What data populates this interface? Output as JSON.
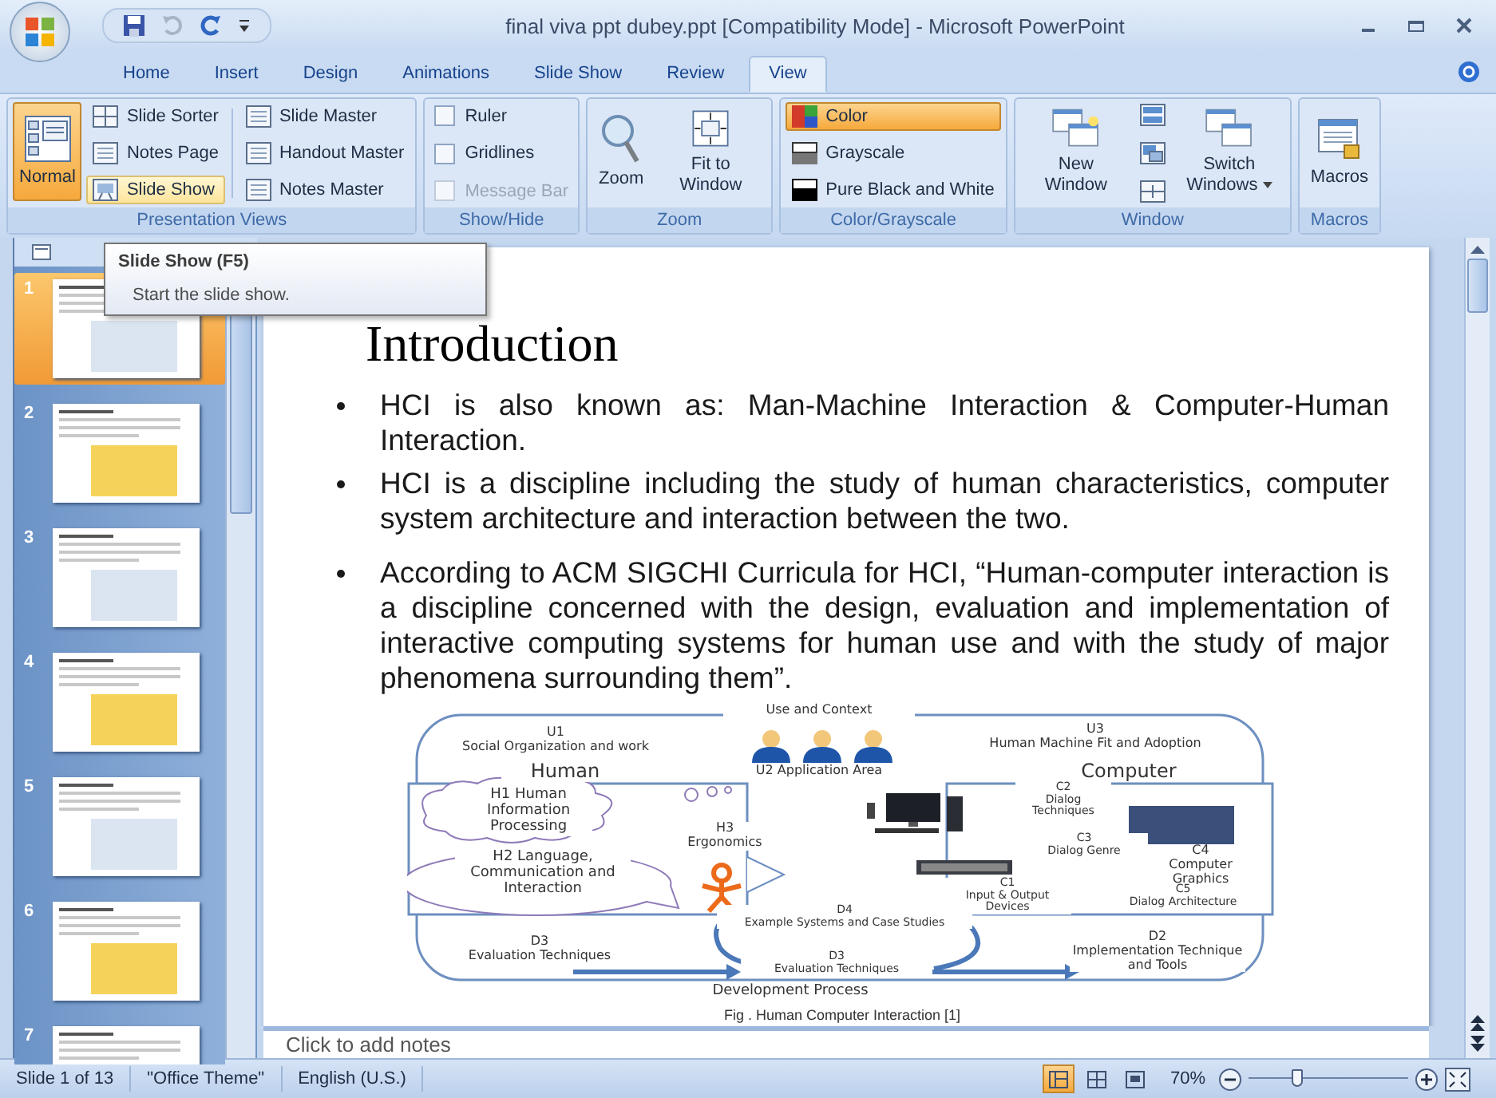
{
  "window": {
    "title": "final viva ppt dubey.ppt [Compatibility Mode] - Microsoft PowerPoint"
  },
  "ribbon_tabs": [
    {
      "label": "Home",
      "selected": false
    },
    {
      "label": "Insert",
      "selected": false
    },
    {
      "label": "Design",
      "selected": false
    },
    {
      "label": "Animations",
      "selected": false
    },
    {
      "label": "Slide Show",
      "selected": false
    },
    {
      "label": "Review",
      "selected": false
    },
    {
      "label": "View",
      "selected": true
    }
  ],
  "ribbon": {
    "groups": [
      {
        "title": "Presentation Views",
        "columns": [
          [
            {
              "kind": "large",
              "label": "Normal",
              "selected": true,
              "hovered": false
            }
          ],
          [
            {
              "kind": "small",
              "label": "Slide Sorter",
              "selected": false,
              "hovered": false
            },
            {
              "kind": "small",
              "label": "Notes Page",
              "selected": false,
              "hovered": false
            },
            {
              "kind": "small",
              "label": "Slide Show",
              "selected": false,
              "hovered": true
            }
          ],
          [
            {
              "kind": "small",
              "label": "Slide Master",
              "selected": false,
              "hovered": false
            },
            {
              "kind": "small",
              "label": "Handout Master",
              "selected": false,
              "hovered": false
            },
            {
              "kind": "small",
              "label": "Notes Master",
              "selected": false,
              "hovered": false
            }
          ]
        ]
      },
      {
        "title": "Show/Hide",
        "columns": [
          [
            {
              "kind": "check",
              "label": "Ruler",
              "checked": false,
              "disabled": false
            },
            {
              "kind": "check",
              "label": "Gridlines",
              "checked": false,
              "disabled": false
            },
            {
              "kind": "check",
              "label": "Message Bar",
              "checked": false,
              "disabled": true
            }
          ]
        ]
      },
      {
        "title": "Zoom",
        "columns": [
          [
            {
              "kind": "large",
              "label": "Zoom"
            }
          ],
          [
            {
              "kind": "large",
              "label": "Fit to Window"
            }
          ]
        ]
      },
      {
        "title": "Color/Grayscale",
        "columns": [
          [
            {
              "kind": "small",
              "label": "Color",
              "selected": true
            },
            {
              "kind": "small",
              "label": "Grayscale",
              "selected": false
            },
            {
              "kind": "small",
              "label": "Pure Black and White",
              "selected": false
            }
          ]
        ]
      },
      {
        "title": "Window",
        "columns": [
          [
            {
              "kind": "large",
              "label": "New Window"
            }
          ],
          [
            {
              "kind": "icon"
            },
            {
              "kind": "icon"
            },
            {
              "kind": "icon"
            }
          ],
          [
            {
              "kind": "large",
              "label": "Switch Windows"
            }
          ]
        ]
      },
      {
        "title": "Macros",
        "columns": [
          [
            {
              "kind": "large",
              "label": "Macros"
            }
          ]
        ]
      }
    ]
  },
  "tooltip": {
    "title": "Slide Show (F5)",
    "description": "Start the slide show."
  },
  "slides": [
    {
      "number": "1",
      "selected": true
    },
    {
      "number": "2",
      "selected": false
    },
    {
      "number": "3",
      "selected": false
    },
    {
      "number": "4",
      "selected": false
    },
    {
      "number": "5",
      "selected": false
    },
    {
      "number": "6",
      "selected": false
    },
    {
      "number": "7",
      "selected": false
    }
  ],
  "slide": {
    "title": "Introduction",
    "bullets": [
      "HCI is also known as: Man-Machine Interaction & Computer-Human Interaction.",
      "HCI is a discipline including the study of human characteristics, computer system architecture and interaction between the two.",
      "According to ACM SIGCHI Curricula for HCI, “Human-computer interaction is a discipline concerned with the design, evaluation and implementation of interactive computing systems for human use and with the study of major phenomena surrounding them”."
    ],
    "figure": {
      "labels": [
        {
          "text": "Use and Context"
        },
        {
          "code": "U1",
          "text": "Social Organization and work"
        },
        {
          "text": "U2 Application Area"
        },
        {
          "code": "U3",
          "text": "Human Machine Fit and Adoption"
        },
        {
          "text": "Human"
        },
        {
          "text": "Computer"
        },
        {
          "text": "H1 Human Information Processing"
        },
        {
          "text": "H2 Language, Communication and Interaction"
        },
        {
          "code": "H3",
          "text": "Ergonomics"
        },
        {
          "code": "C2",
          "text": "Dialog Techniques"
        },
        {
          "code": "C3",
          "text": "Dialog Genre"
        },
        {
          "code": "C4",
          "text": "Computer Graphics"
        },
        {
          "code": "C1",
          "text": "Input & Output Devices"
        },
        {
          "code": "C5",
          "text": "Dialog Architecture"
        },
        {
          "code": "D4",
          "text": "Example Systems and Case Studies"
        },
        {
          "code": "D3",
          "text": "Evaluation Techniques"
        },
        {
          "code": "D3",
          "text": "Evaluation Techniques"
        },
        {
          "code": "D2",
          "text": "Implementation Technique and Tools"
        },
        {
          "text": "Development Process"
        }
      ],
      "caption": "Fig . Human Computer Interaction [1]"
    }
  },
  "notes": {
    "placeholder": "Click to add notes"
  },
  "status_bar": {
    "slide": "Slide 1 of 13",
    "theme": "\"Office Theme\"",
    "language": "English (U.S.)",
    "views": [
      {
        "selected": true
      },
      {
        "selected": false
      },
      {
        "selected": false
      }
    ],
    "zoom": "70%",
    "zoom_slider": {
      "level": 0.3
    }
  }
}
